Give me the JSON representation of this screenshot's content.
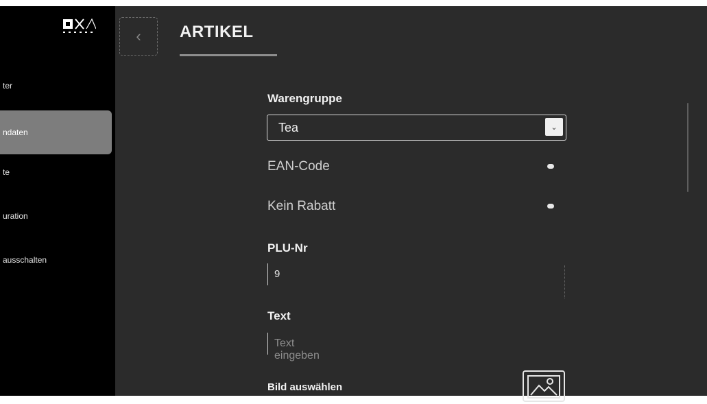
{
  "sidebar": {
    "items": [
      {
        "label": "ter"
      },
      {
        "label": "ndaten",
        "active": true
      },
      {
        "label": "te"
      },
      {
        "label": "uration"
      },
      {
        "label": "ausschalten"
      }
    ]
  },
  "header": {
    "title": "ARTIKEL"
  },
  "form": {
    "warengruppe_label": "Warengruppe",
    "warengruppe_value": "Tea",
    "ean_label": "EAN-Code",
    "rabatt_label": "Kein Rabatt",
    "plu_label": "PLU-Nr",
    "plu_value": "9",
    "text_label": "Text",
    "text_placeholder": "Text eingeben",
    "image_label": "Bild auswählen"
  },
  "colors": {
    "background": "#2b2b2b",
    "sidebar": "#000000",
    "active_item": "#7d7d7d"
  }
}
